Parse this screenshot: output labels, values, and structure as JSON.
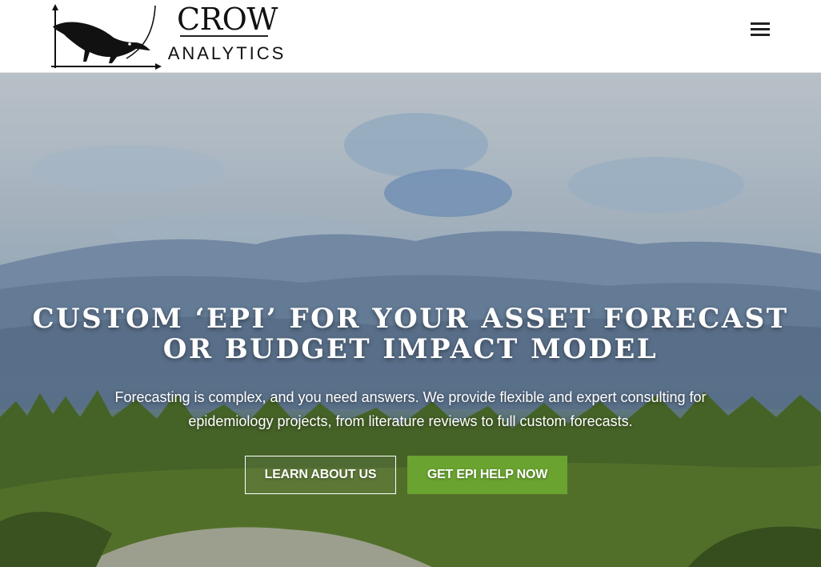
{
  "brand": {
    "name": "CROW",
    "tagline": "ANALYTICS"
  },
  "header": {
    "menu_icon": "hamburger-menu-icon"
  },
  "hero": {
    "title_line1": "CUSTOM ‘EPI’ FOR YOUR ASSET FORECAST",
    "title_line2": "OR BUDGET IMPACT MODEL",
    "subtitle_line1": "Forecasting is complex, and you need answers. We provide flexible and expert consulting for",
    "subtitle_line2": "epidemiology projects, from literature reviews to full custom forecasts.",
    "background": "mountain-landscape-image"
  },
  "buttons": {
    "learn": "LEARN ABOUT US",
    "help": "GET EPI HELP NOW"
  },
  "colors": {
    "accent_green": "#6aa330",
    "header_bg": "#ffffff",
    "text_light": "#ffffff"
  }
}
